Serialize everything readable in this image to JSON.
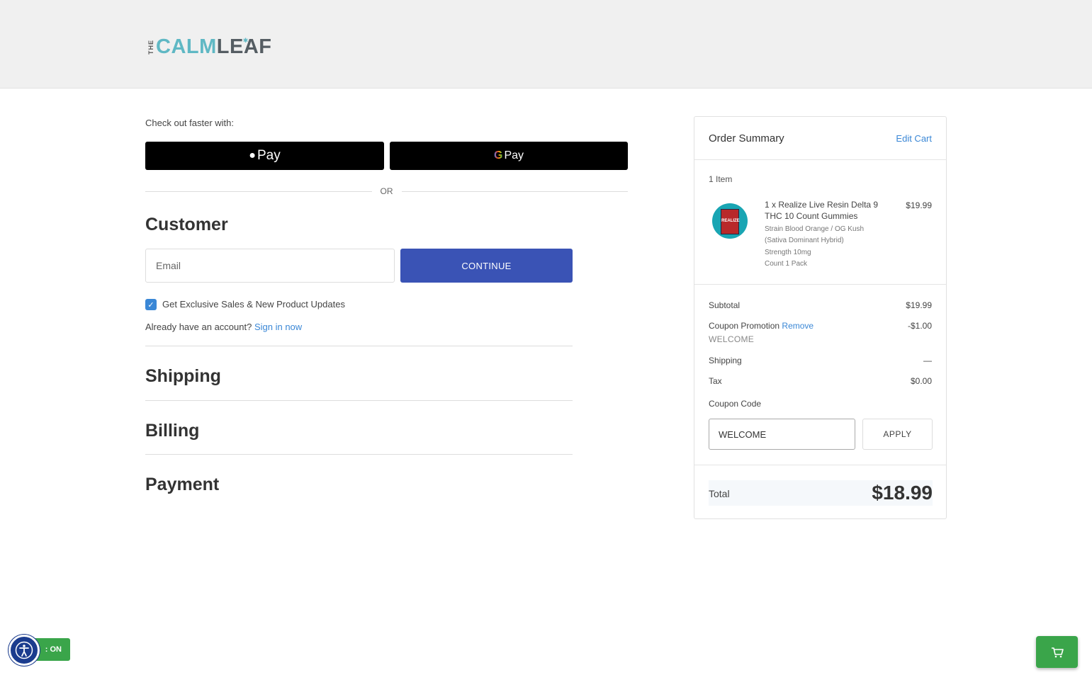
{
  "brand": {
    "the": "THE",
    "calm": "CALM",
    "leaf": "LEAF"
  },
  "express": {
    "label": "Check out faster with:",
    "apple_pay": "Pay",
    "google_pay": "Pay",
    "or": "OR"
  },
  "customer": {
    "title": "Customer",
    "email_placeholder": "Email",
    "continue_label": "CONTINUE",
    "newsletter_label": "Get Exclusive Sales & New Product Updates",
    "newsletter_checked": true,
    "account_prompt": "Already have an account?",
    "sign_in_label": "Sign in now"
  },
  "sections": {
    "shipping": "Shipping",
    "billing": "Billing",
    "payment": "Payment"
  },
  "summary": {
    "title": "Order Summary",
    "edit_cart": "Edit Cart",
    "item_count": "1 Item",
    "item": {
      "name": "1 x Realize Live Resin Delta 9 THC 10 Count Gummies",
      "price": "$19.99",
      "pack_text": "REALIZE",
      "option_strain": "Strain Blood Orange / OG Kush",
      "option_strain_2": "(Sativa Dominant Hybrid)",
      "option_strength": "Strength 10mg",
      "option_count": "Count 1 Pack"
    },
    "subtotal_label": "Subtotal",
    "subtotal_value": "$19.99",
    "coupon_label": "Coupon Promotion",
    "coupon_remove": "Remove",
    "coupon_value": "-$1.00",
    "coupon_code_applied": "WELCOME",
    "shipping_label": "Shipping",
    "shipping_value": "—",
    "tax_label": "Tax",
    "tax_value": "$0.00",
    "coupon_code_label": "Coupon Code",
    "coupon_input_value": "WELCOME",
    "apply_label": "APPLY",
    "total_label": "Total",
    "total_value": "$18.99"
  },
  "widgets": {
    "accessibility_toggle": ": ON"
  },
  "icons": {
    "accessibility": "accessibility-icon",
    "cart": "cart-icon",
    "apple": "apple-icon",
    "google": "google-icon",
    "checkmark": "checkmark-icon"
  },
  "colors": {
    "accent_blue": "#3a53b5",
    "link_blue": "#3a87d6",
    "brand_teal": "#5fb8c4",
    "widget_green": "#3aa54a"
  }
}
